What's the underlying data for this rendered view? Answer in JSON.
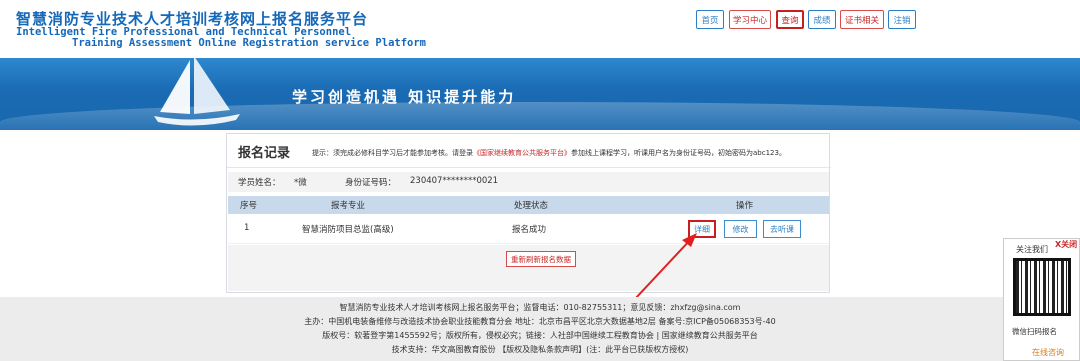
{
  "header": {
    "title_cn": "智慧消防专业技术人才培训考核网上报名服务平台",
    "title_en_line1": "Intelligent Fire Professional and Technical Personnel",
    "title_en_line2": "Training Assessment Online Registration service Platform"
  },
  "nav": {
    "items": [
      {
        "label": "首页"
      },
      {
        "label": "学习中心"
      },
      {
        "label": "查询"
      },
      {
        "label": "成绩"
      },
      {
        "label": "证书相关"
      },
      {
        "label": "注销"
      }
    ]
  },
  "banner": {
    "slogan": "学习创造机遇  知识提升能力"
  },
  "panel": {
    "title": "报名记录",
    "tip_prefix": "提示：须完成必修科目学习后才能参加考核。请登录",
    "tip_link": "《国家继续教育公共服务平台》",
    "tip_suffix": "参加线上课程学习，听课用户名为身份证号码，初始密码为abc123。",
    "student_label": "学员姓名：",
    "student_value": "*微",
    "id_label": "身份证号码：",
    "id_value": "230407********0021",
    "table": {
      "headers": [
        "序号",
        "报考专业",
        "处理状态",
        "操作"
      ],
      "rows": [
        {
          "index": "1",
          "major": "智慧消防项目总监(高级)",
          "status": "报名成功",
          "actions": [
            "详细",
            "修改",
            "去听课"
          ]
        }
      ]
    },
    "refresh_label": "重新刷新报名数据"
  },
  "footer": {
    "line1": "智慧消防专业技术人才培训考核网上报名服务平台；监督电话：010-82755311；意见反馈：zhxfzg@sina.com",
    "line2": "主办：中国机电装备维修与改造技术协会职业技能教育分会  地址：北京市昌平区北京大数据基地2层  备案号:京ICP备05068353号-40",
    "line3": "版权号：软著登字第1455592号；版权所有，侵权必究；链接：人社部中国继续工程教育协会 | 国家继续教育公共服务平台",
    "line4": "技术支持：华文高图教育股份 【版权及隐私条款声明】(注：此平台已获版权方授权)"
  },
  "qr_popup": {
    "title": "关注我们",
    "close": "X关闭",
    "caption": "微信扫码报名",
    "contact": "在线咨询"
  },
  "colors": {
    "brand_blue": "#1568b8",
    "highlight_red": "#c81e1e",
    "table_header": "#c7d9ea"
  }
}
